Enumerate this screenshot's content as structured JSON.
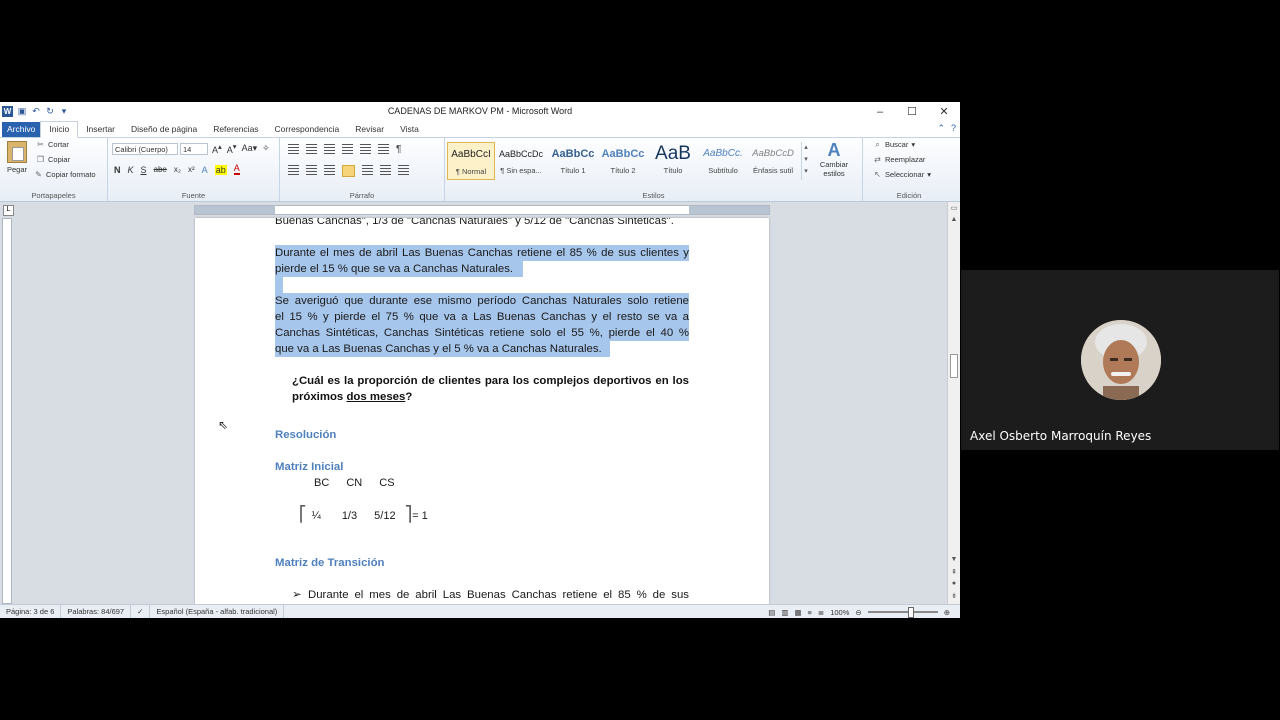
{
  "window": {
    "title": "CADENAS DE MARKOV PM - Microsoft Word",
    "app_letter": "W",
    "controls": [
      "–",
      "☐",
      "✕"
    ]
  },
  "ribbon_tabs": [
    "Archivo",
    "Inicio",
    "Insertar",
    "Diseño de página",
    "Referencias",
    "Correspondencia",
    "Revisar",
    "Vista"
  ],
  "clipboard": {
    "paste": "Pegar",
    "cut": "Cortar",
    "copy": "Copiar",
    "format_painter": "Copiar formato",
    "group": "Portapapeles"
  },
  "font": {
    "name": "Calibri (Cuerpo)",
    "size": "14",
    "bold": "N",
    "italic": "K",
    "underline": "S",
    "strike": "abe",
    "sub": "x₂",
    "sup": "x²",
    "group": "Fuente"
  },
  "paragraph": {
    "group": "Párrafo",
    "pilcrow": "¶"
  },
  "styles": {
    "group": "Estilos",
    "items": [
      {
        "preview": "AaBbCcI",
        "name": "¶ Normal"
      },
      {
        "preview": "AaBbCcDc",
        "name": "¶ Sin espa..."
      },
      {
        "preview": "AaBbCc",
        "name": "Título 1"
      },
      {
        "preview": "AaBbCc",
        "name": "Título 2"
      },
      {
        "preview": "AaB",
        "name": "Título"
      },
      {
        "preview": "AaBbCc.",
        "name": "Subtítulo"
      },
      {
        "preview": "AaBbCcD",
        "name": "Énfasis sutil"
      }
    ],
    "change_label_1": "Cambiar",
    "change_label_2": "estilos"
  },
  "editing": {
    "group": "Edición",
    "find": "Buscar",
    "replace": "Reemplazar",
    "select": "Seleccionar"
  },
  "document": {
    "top_line": "Buenas Canchas\", 1/3 de \"Canchas Naturales\" y 5/12 de \"Canchas Sintéticas\".",
    "p1_l1": "Durante el mes de abril Las Buenas Canchas retiene el 85 % de sus clientes y",
    "p1_l2": "pierde el 15 % que se va a Canchas Naturales.",
    "p2_l1": "Se averiguó que durante ese mismo período Canchas Naturales solo retiene",
    "p2_l2": "el 15 % y pierde el 75 % que va a Las Buenas Canchas y el resto se va a",
    "p2_l3": "Canchas Sintéticas, Canchas Sintéticas retiene solo el 55 %, pierde el 40 %",
    "p2_l4": "que va a Las Buenas Canchas y el 5 % va a Canchas Naturales.",
    "question_l1": "¿Cuál es la proporción de clientes para los complejos deportivos en los",
    "question_l2_a": "próximos ",
    "question_l2_u": "dos meses",
    "question_l2_b": "?",
    "resolucion": "Resolución",
    "matriz_inicial": "Matriz Inicial",
    "cols": [
      "BC",
      "CN",
      "CS"
    ],
    "vector": [
      "¼",
      "1/3",
      "5/12"
    ],
    "vector_eq": "= 1",
    "matriz_transicion": "Matriz de Transición",
    "bullet_text": "Durante el mes de abril Las Buenas Canchas retiene el 85 % de sus"
  },
  "status": {
    "page": "Página: 3 de 6",
    "words": "Palabras: 84/697",
    "language": "Español (España - alfab. tradicional)",
    "zoom": "100%"
  },
  "participant": {
    "name": "Axel Osberto Marroquín Reyes"
  }
}
